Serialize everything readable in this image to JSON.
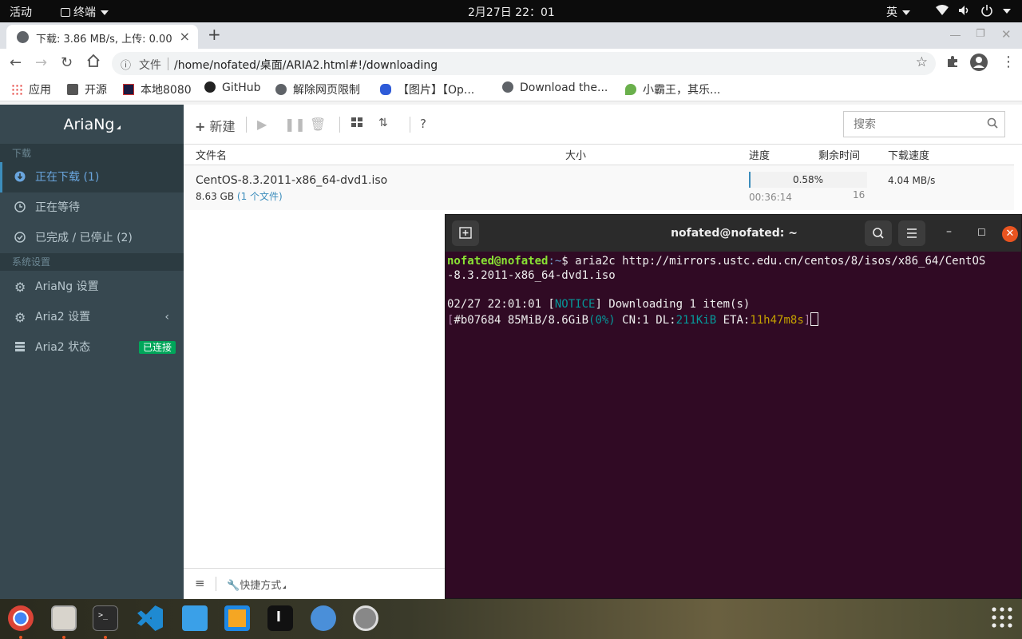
{
  "topbar": {
    "activities": "活动",
    "app_menu": "终端",
    "clock": "2月27日  22：01",
    "input_method": "英"
  },
  "browser": {
    "tab_title": "下载: 3.86 MB/s, 上传: 0.00",
    "tab_close": "×",
    "new_tab": "+",
    "omnibox": {
      "scheme_label": "文件",
      "url": "/home/nofated/桌面/ARIA2.html#!/downloading"
    },
    "bookmarks": [
      "应用",
      "开源",
      "本地8080",
      "GitHub",
      "解除网页限制",
      "【图片】【Op...",
      "Download the...",
      "小霸王，其乐..."
    ]
  },
  "ariang": {
    "brand": "AriaNg",
    "sidebar": {
      "section_download": "下载",
      "downloading": "正在下载 (1)",
      "waiting": "正在等待",
      "stopped": "已完成 / 已停止 (2)",
      "section_settings": "系统设置",
      "ariang_settings": "AriaNg 设置",
      "aria2_settings": "Aria2 设置",
      "aria2_status": "Aria2 状态",
      "connected_badge": "已连接"
    },
    "toolbar": {
      "new_label": "新建",
      "search_placeholder": "搜索"
    },
    "columns": {
      "name": "文件名",
      "size": "大小",
      "progress": "进度",
      "remaining": "剩余时间",
      "speed": "下载速度"
    },
    "tasks": [
      {
        "name": "CentOS-8.3.2011-x86_64-dvd1.iso",
        "size": "8.63 GB",
        "files": "(1 个文件)",
        "progress_text": "0.58%",
        "progress_value": 0.0058,
        "remaining": "00:36:14",
        "connections": "16",
        "speed": "4.04 MB/s"
      }
    ],
    "footer": {
      "shortcuts": "快捷方式"
    }
  },
  "terminal": {
    "title": "nofated@nofated: ~",
    "prompt_user": "nofated@nofated",
    "prompt_path": ":~",
    "prompt_symbol": "$",
    "command_line1": " aria2c http://mirrors.ustc.edu.cn/centos/8/isos/x86_64/CentOS",
    "command_line2": "-8.3.2011-x86_64-dvd1.iso",
    "notice_time": "02/27 22:01:01 [",
    "notice_tag": "NOTICE",
    "notice_msg": "] Downloading 1 item(s)",
    "status_open": "[",
    "status_gid": "#b07684 85MiB/8.6GiB",
    "status_pct": "(0%)",
    "status_cn": " CN:1 DL:",
    "status_dl": "211KiB",
    "status_eta_label": " ETA:",
    "status_eta": "11h47m8s",
    "status_close": "]"
  },
  "colors": {
    "ariang_accent": "#3c8dbc",
    "sidebar_bg": "#374850",
    "terminal_bg": "#300a24",
    "ubuntu_orange": "#e95420",
    "badge_green": "#00a65a"
  }
}
